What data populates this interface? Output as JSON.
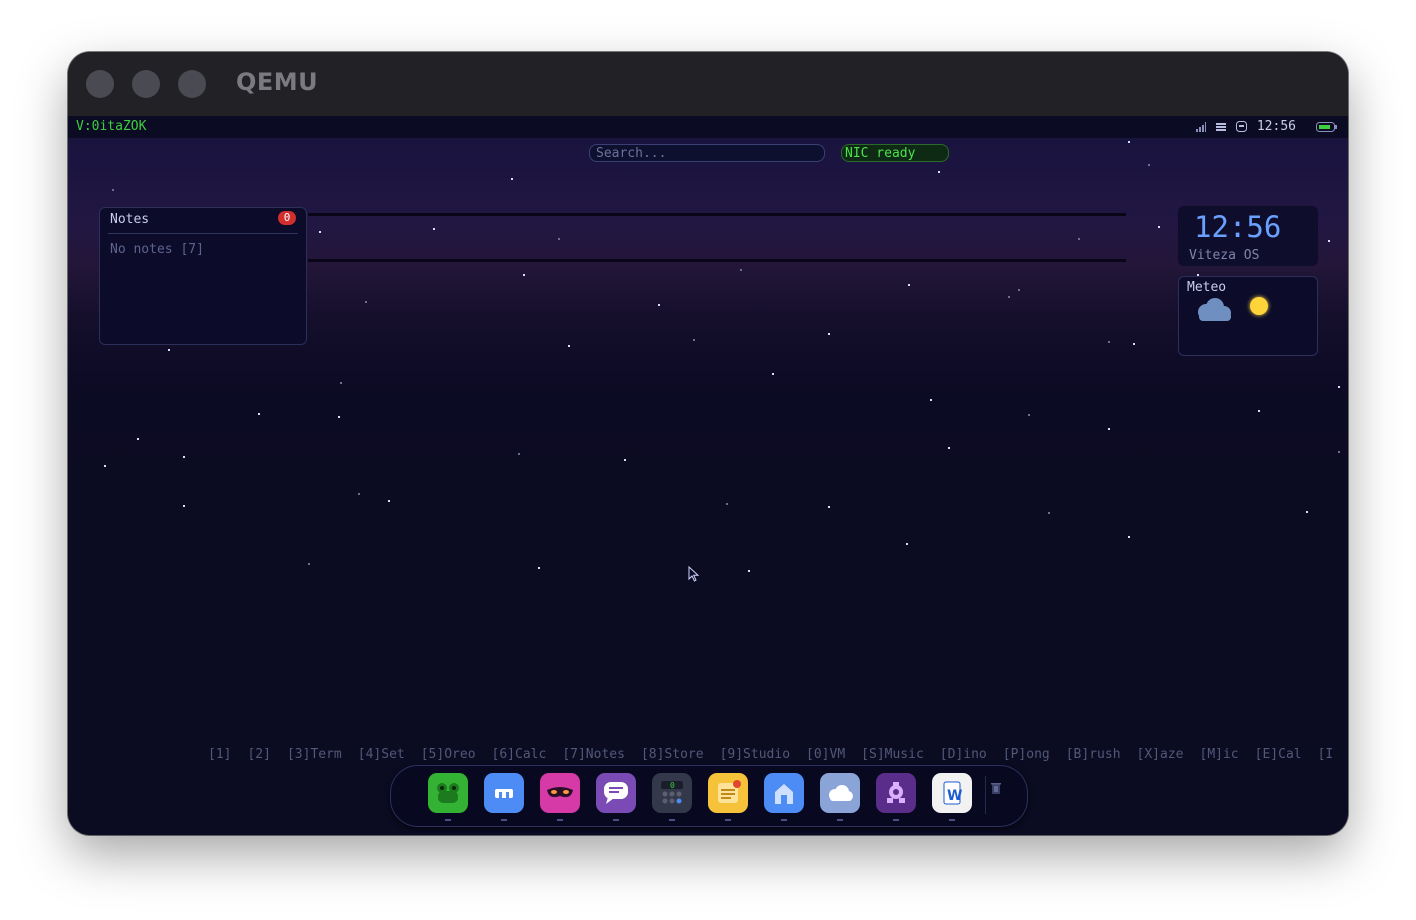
{
  "window": {
    "title": "QEMU"
  },
  "topbar": {
    "os_label": "V:0itaZOK",
    "time": "12:56"
  },
  "search": {
    "placeholder": "Search..."
  },
  "status": {
    "nic": "NIC ready"
  },
  "notes_widget": {
    "title": "Notes",
    "badge": "0",
    "empty_text": "No notes  [7]"
  },
  "clock_widget": {
    "time": "12:56",
    "os_name": "Viteza OS"
  },
  "meteo_widget": {
    "title": "Meteo",
    "icons": [
      "cloud-icon",
      "sun-icon"
    ]
  },
  "shortcuts": [
    "[1]",
    "[2]",
    "[3]Term",
    "[4]Set",
    "[5]Oreo",
    "[6]Calc",
    "[7]Notes",
    "[8]Store",
    "[9]Studio",
    "[0]VM",
    "[S]Music",
    "[D]ino",
    "[P]ong",
    "[B]rush",
    "[X]aze",
    "[M]ic",
    "[E]Cal",
    "[I"
  ],
  "dock": {
    "apps": [
      {
        "name": "frog-app-icon",
        "color": "#34b234"
      },
      {
        "name": "settings-app-icon",
        "color": "#4d8cf5"
      },
      {
        "name": "mask-app-icon",
        "color": "#d63aa6"
      },
      {
        "name": "chat-app-icon",
        "color": "#7b4bb5"
      },
      {
        "name": "calculator-app-icon",
        "color": "#33384a",
        "label": "0"
      },
      {
        "name": "notes-app-icon",
        "color": "#f6c23a"
      },
      {
        "name": "store-app-icon",
        "color": "#4d8cf5"
      },
      {
        "name": "weather-app-icon",
        "color": "#8aa4d8"
      },
      {
        "name": "studio-app-icon",
        "color": "#5a2d8a"
      },
      {
        "name": "writer-app-icon",
        "color": "#f2f2f2",
        "label": "W"
      }
    ],
    "trash_icon": "trash-icon"
  },
  "colors": {
    "accent_green": "#3ecf3e",
    "clock_blue": "#6aa0ff",
    "badge_red": "#d22e2e"
  }
}
